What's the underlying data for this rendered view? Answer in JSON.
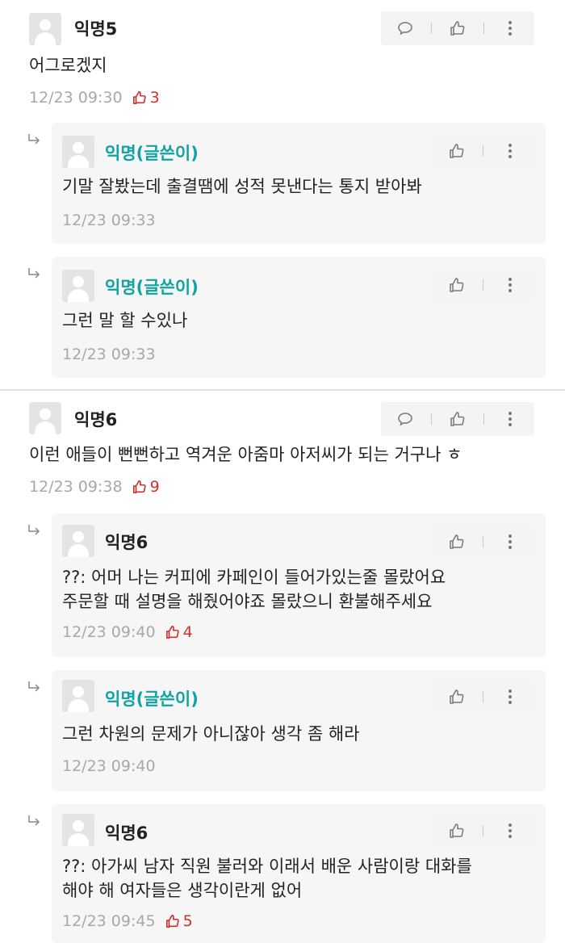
{
  "comments": [
    {
      "author": "익명5",
      "text": "어그로겠지",
      "time": "12/23 09:30",
      "likes": "3"
    },
    {
      "author": "익명6",
      "text": "이런 애들이 뻔뻔하고 역겨운 아줌마 아저씨가 되는 거구나 ㅎ",
      "time": "12/23 09:38",
      "likes": "9"
    }
  ],
  "replies": [
    {
      "author": "익명(글쓴이)",
      "lines": [
        "기말 잘봤는데 출결땜에 성적 못낸다는 통지 받아봐"
      ],
      "time": "12/23 09:33"
    },
    {
      "author": "익명(글쓴이)",
      "lines": [
        "그런 말 할 수있나"
      ],
      "time": "12/23 09:33"
    },
    {
      "author": "익명6",
      "lines": [
        "??: 어머 나는 커피에 카페인이 들어가있는줄 몰랐어요",
        "주문할 때 설명을 해줬어야죠 몰랐으니 환불해주세요"
      ],
      "time": "12/23 09:40",
      "likes": "4"
    },
    {
      "author": "익명(글쓴이)",
      "lines": [
        "그런 차원의 문제가 아니잖아 생각 좀 해라"
      ],
      "time": "12/23 09:40"
    },
    {
      "author": "익명6",
      "lines": [
        "??: 아가씨 남자 직원 불러와 이래서 배운 사람이랑 대화를",
        "해야 해 여자들은 생각이란게 없어"
      ],
      "time": "12/23 09:45",
      "likes": "5"
    }
  ],
  "icons": {
    "avatar": "default-profile-icon",
    "reply_action": "speech-bubble-icon",
    "like_action": "thumbs-up-icon",
    "more_action": "vertical-ellipsis-icon",
    "reply_indicator": "reply-arrow-icon"
  },
  "colors": {
    "op_author": "#10a3a3",
    "like_count": "#d0302c",
    "meta_text": "#a8a8a8",
    "reply_background": "#f6f6f6",
    "toolbar_background": "#f4f4f4"
  }
}
